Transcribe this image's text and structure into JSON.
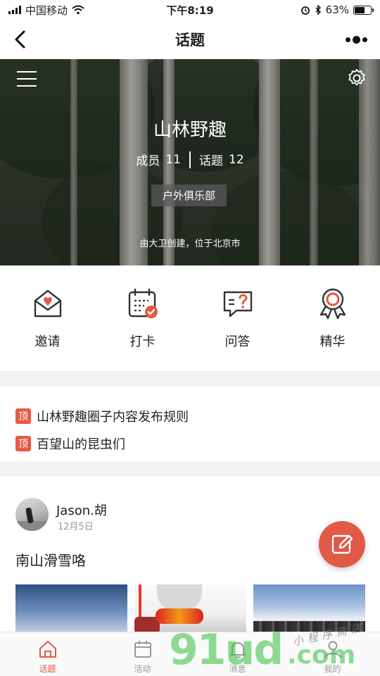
{
  "status_bar": {
    "carrier": "中国移动",
    "time": "下午8:19",
    "battery": "63%",
    "battery_fraction": 0.63
  },
  "nav": {
    "title": "话题",
    "back_icon": "chevron-left-icon",
    "more_icon": "more-dots-icon"
  },
  "hero": {
    "group_name": "山林野趣",
    "members_label": "成员",
    "members_count": "11",
    "topics_label": "话题",
    "topics_count": "12",
    "category_tag": "户外俱乐部",
    "creator_line": "由大卫创建，位于北京市",
    "menu_icon": "hamburger-menu-icon",
    "settings_icon": "gear-icon"
  },
  "actions": [
    {
      "label": "邀请",
      "icon": "envelope-heart-icon"
    },
    {
      "label": "打卡",
      "icon": "calendar-check-icon"
    },
    {
      "label": "问答",
      "icon": "question-bubble-icon"
    },
    {
      "label": "精华",
      "icon": "award-ribbon-icon"
    }
  ],
  "pinned": {
    "badge": "顶",
    "items": [
      {
        "title": "山林野趣圈子内容发布规则"
      },
      {
        "title": "百望山的昆虫们"
      }
    ]
  },
  "post": {
    "author": "Jason.胡",
    "date": "12月5日",
    "title": "南山滑雪咯"
  },
  "fab": {
    "icon": "edit-pencil-icon"
  },
  "tabbar": {
    "items": [
      {
        "label": "话题",
        "icon": "home-icon",
        "active": true
      },
      {
        "label": "活动",
        "icon": "calendar-icon",
        "active": false
      },
      {
        "label": "消息",
        "icon": "bell-icon",
        "active": false
      },
      {
        "label": "我的",
        "icon": "user-icon",
        "active": false
      }
    ]
  },
  "watermark": {
    "main": "91ud",
    "suffix": ".com",
    "handwritten": "小程序商店"
  },
  "colors": {
    "accent": "#e05a45",
    "badge": "#e55a44",
    "divider": "#f3f3f3"
  }
}
